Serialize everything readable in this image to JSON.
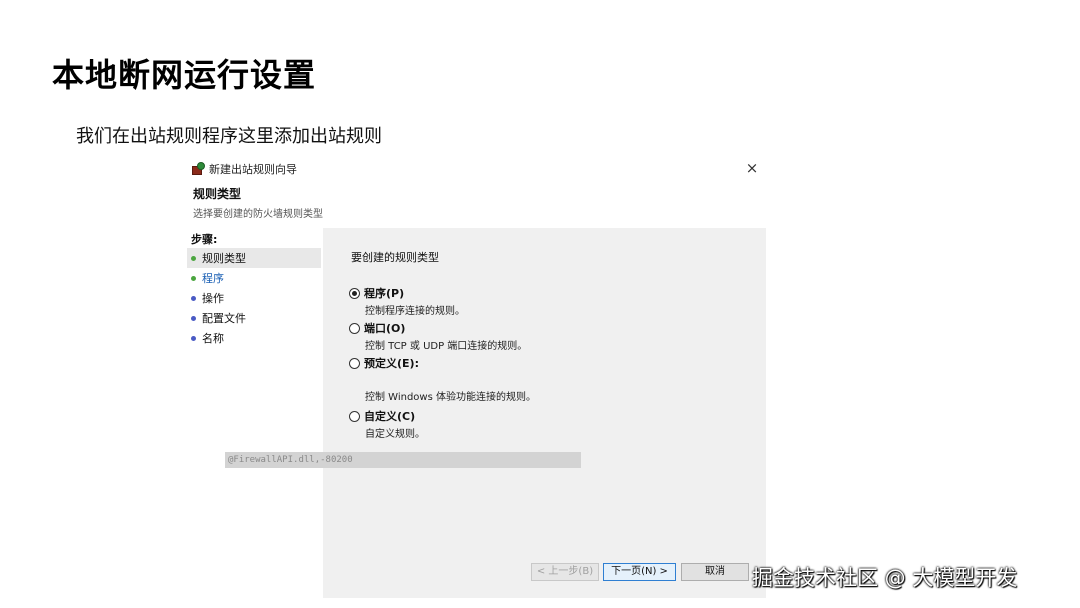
{
  "slide": {
    "title": "本地断网运行设置",
    "subtitle": "我们在出站规则程序这里添加出站规则"
  },
  "dialog": {
    "window_title": "新建出站规则向导",
    "close_glyph": "×",
    "heading": "规则类型",
    "description": "选择要创建的防火墙规则类型",
    "steps_label": "步骤:",
    "steps": [
      {
        "label": "规则类型",
        "dot": "green",
        "active": true
      },
      {
        "label": "程序",
        "dot": "green",
        "active": false
      },
      {
        "label": "操作",
        "dot": "blue",
        "active": false
      },
      {
        "label": "配置文件",
        "dot": "blue",
        "active": false
      },
      {
        "label": "名称",
        "dot": "blue",
        "active": false
      }
    ],
    "pane_title": "要创建的规则类型",
    "options": [
      {
        "label": "程序(P)",
        "desc": "控制程序连接的规则。",
        "checked": true
      },
      {
        "label": "端口(O)",
        "desc": "控制 TCP 或 UDP 端口连接的规则。",
        "checked": false
      },
      {
        "label": "预定义(E):",
        "desc": "控制 Windows 体验功能连接的规则。",
        "checked": false
      },
      {
        "label": "自定义(C)",
        "desc": "自定义规则。",
        "checked": false
      }
    ],
    "predefined_value": "@FirewallAPI.dll,-80200",
    "buttons": {
      "back": "< 上一步(B)",
      "next": "下一页(N) >",
      "cancel": "取消"
    }
  },
  "watermark": "掘金技术社区 @ 大模型开发",
  "colors": {
    "step_dot_green": "#4ca640",
    "step_dot_blue": "#4a5bc4",
    "link_blue": "#1a5fb4",
    "pane_bg": "#f0f0f0"
  }
}
